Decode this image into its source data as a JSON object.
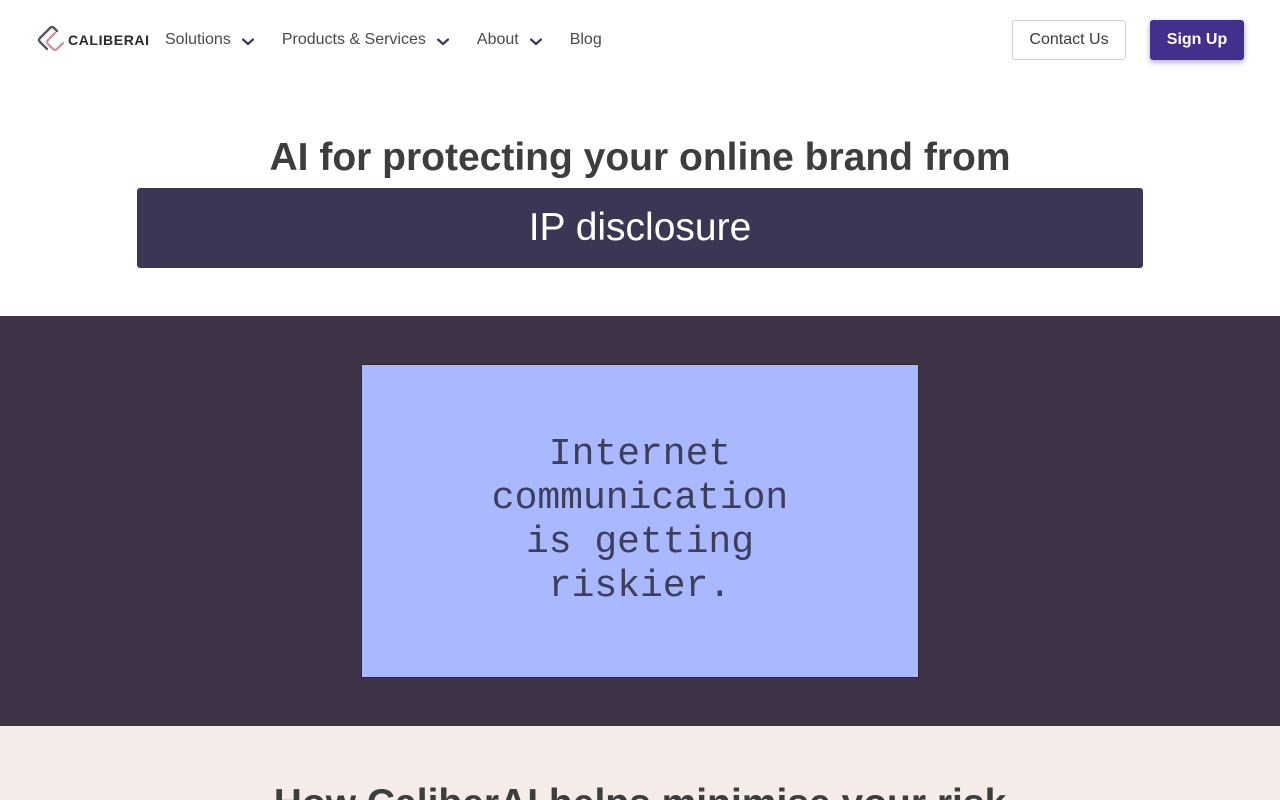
{
  "brand": {
    "name": "CALIBERAI"
  },
  "nav": {
    "items": [
      {
        "label": "Solutions",
        "has_dropdown": true
      },
      {
        "label": "Products & Services",
        "has_dropdown": true
      },
      {
        "label": "About",
        "has_dropdown": true
      },
      {
        "label": "Blog",
        "has_dropdown": false
      }
    ],
    "contact_label": "Contact Us",
    "signup_label": "Sign Up"
  },
  "hero": {
    "title": "AI for protecting your online brand from",
    "highlight": "IP disclosure"
  },
  "feature_card": {
    "text": "Internet communication is getting riskier."
  },
  "section": {
    "title": "How CaliberAI helps minimise your risk"
  },
  "colors": {
    "accent": "#43308c",
    "hero_bar": "#3b3654",
    "dark_section": "#3e3347",
    "card": "#aab8ff",
    "bottom_section": "#f5ebe8"
  },
  "icons": {
    "logo": "caliberai-logo-icon",
    "dropdown": "chevron-down-icon"
  }
}
